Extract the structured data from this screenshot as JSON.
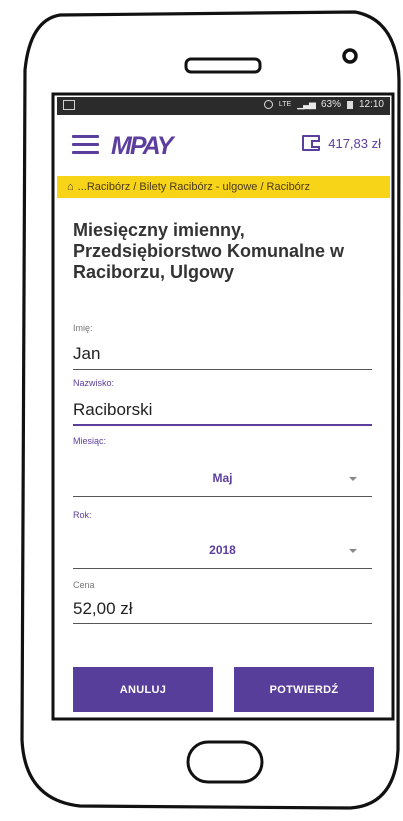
{
  "statusbar": {
    "network": "LTE",
    "battery": "63%",
    "time": "12:10"
  },
  "app": {
    "logo": "MPAY",
    "balance": "417,83 zł"
  },
  "breadcrumb": {
    "text": "...Racibórz / Bilety Racibórz - ulgowe / Racibórz"
  },
  "ticket": {
    "title": "Miesięczny imienny, Przedsiębiorstwo Komunalne w Raciborzu, Ulgowy"
  },
  "form": {
    "first_name_label": "Imię:",
    "first_name_value": "Jan",
    "last_name_label": "Nazwisko:",
    "last_name_value": "Raciborski",
    "month_label": "Miesiąc:",
    "month_value": "Maj",
    "year_label": "Rok:",
    "year_value": "2018",
    "price_label": "Cena",
    "price_value": "52,00 zł"
  },
  "buttons": {
    "cancel": "ANULUJ",
    "confirm": "POTWIERDŹ"
  },
  "colors": {
    "brand": "#5c3e9e",
    "breadcrumb_bg": "#f7d417",
    "button_bg": "#583e9b"
  }
}
